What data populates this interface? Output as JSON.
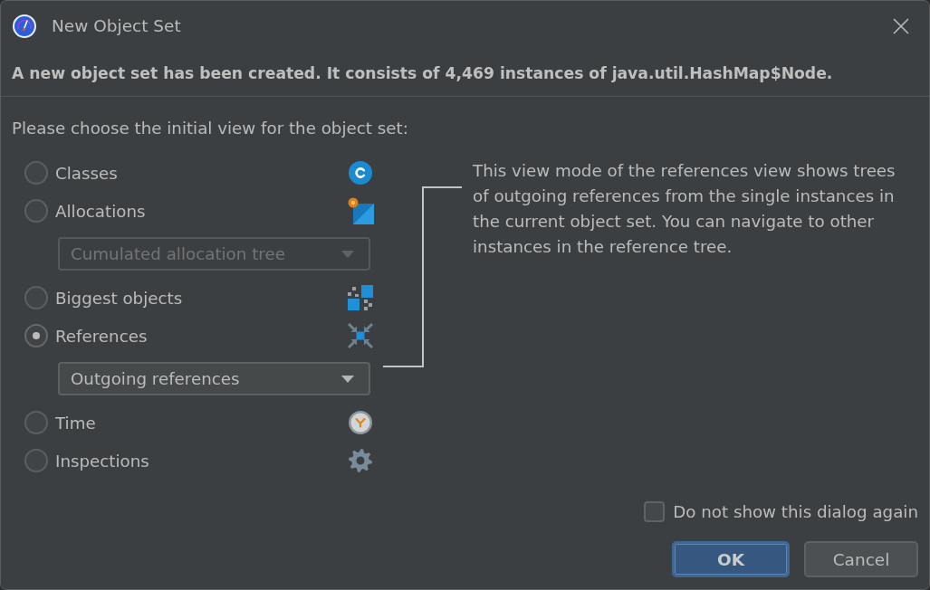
{
  "window": {
    "title": "New Object Set"
  },
  "message": "A new object set has been created. It consists of 4,469 instances of java.util.HashMap$Node.",
  "prompt": "Please choose the initial view for the object set:",
  "views": [
    {
      "label": "Classes",
      "kind": "classes",
      "selected": false
    },
    {
      "label": "Allocations",
      "kind": "allocations",
      "selected": false,
      "dropdown": {
        "value": "Cumulated allocation tree",
        "disabled": true
      }
    },
    {
      "label": "Biggest objects",
      "kind": "biggest",
      "selected": false
    },
    {
      "label": "References",
      "kind": "references",
      "selected": true,
      "dropdown": {
        "value": "Outgoing references",
        "disabled": false
      }
    },
    {
      "label": "Time",
      "kind": "time",
      "selected": false
    },
    {
      "label": "Inspections",
      "kind": "inspections",
      "selected": false
    }
  ],
  "description": "This view mode of the references view shows trees of outgoing references from the single instances in the current object set. You can navigate to other instances in the reference tree.",
  "dont_show_again": {
    "label": "Do not show this dialog again",
    "checked": false
  },
  "buttons": [
    {
      "label": "OK",
      "default": true
    },
    {
      "label": "Cancel",
      "default": false
    }
  ]
}
